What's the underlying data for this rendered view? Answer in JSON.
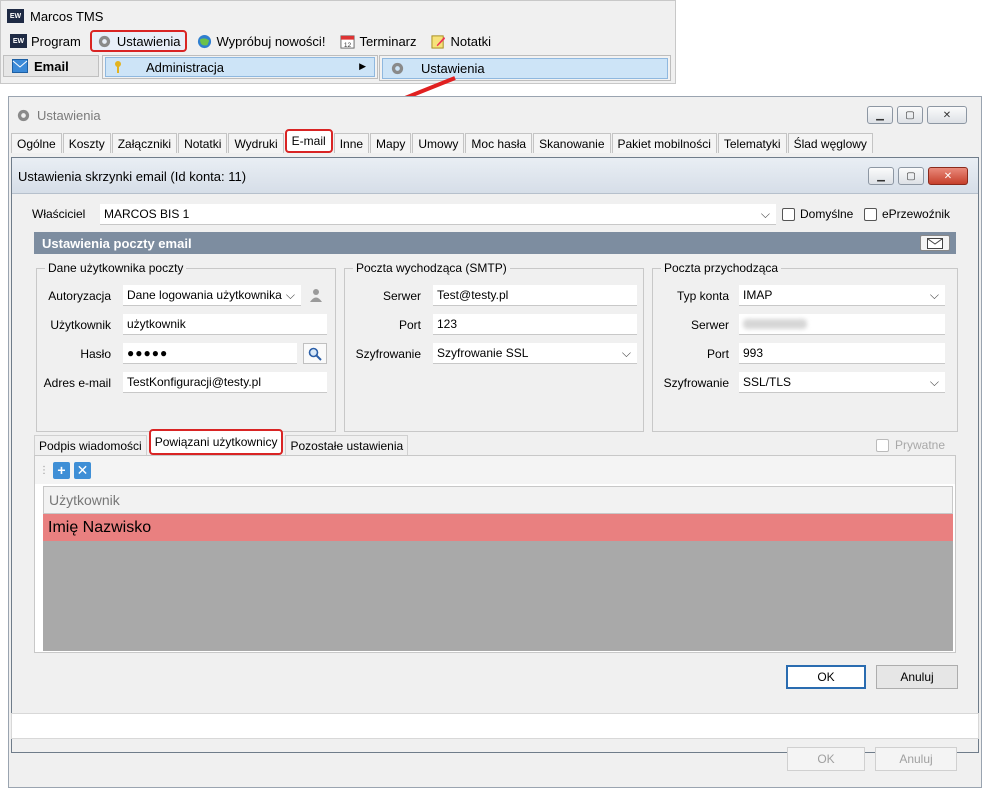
{
  "app": {
    "logo_text": "EW",
    "title": "Marcos TMS",
    "menu": [
      "Program",
      "Ustawienia",
      "Wypróbuj nowości!",
      "Terminarz",
      "Notatki"
    ],
    "email_item": "Email",
    "submenu_item": "Administracja",
    "submenu2_item": "Ustawienia"
  },
  "window": {
    "title": "Ustawienia",
    "tabs": [
      "Ogólne",
      "Koszty",
      "Załączniki",
      "Notatki",
      "Wydruki",
      "E-mail",
      "Inne",
      "Mapy",
      "Umowy",
      "Moc hasła",
      "Skanowanie",
      "Pakiet mobilności",
      "Telematyki",
      "Ślad węglowy"
    ],
    "active_tab": "E-mail",
    "ok_label": "OK",
    "cancel_label": "Anuluj"
  },
  "dialog": {
    "title": "Ustawienia skrzynki email (Id konta: 11)",
    "owner_label": "Właściciel",
    "owner_value": "MARCOS BIS 1",
    "default_label": "Domyślne",
    "carrier_label": "ePrzewoźnik",
    "section_title": "Ustawienia poczty email",
    "user_group": {
      "title": "Dane użytkownika poczty",
      "auth_label": "Autoryzacja",
      "auth_value": "Dane logowania użytkownika",
      "user_label": "Użytkownik",
      "user_value": "użytkownik",
      "password_label": "Hasło",
      "password_value": "●●●●●",
      "email_label": "Adres e-mail",
      "email_value": "TestKonfiguracji@testy.pl"
    },
    "smtp_group": {
      "title": "Poczta wychodząca (SMTP)",
      "server_label": "Serwer",
      "server_value": "Test@testy.pl",
      "port_label": "Port",
      "port_value": "123",
      "enc_label": "Szyfrowanie",
      "enc_value": "Szyfrowanie SSL"
    },
    "incoming_group": {
      "title": "Poczta przychodząca",
      "type_label": "Typ konta",
      "type_value": "IMAP",
      "server_label": "Serwer",
      "port_label": "Port",
      "port_value": "993",
      "enc_label": "Szyfrowanie",
      "enc_value": "SSL/TLS"
    },
    "subtabs": [
      "Podpis wiadomości",
      "Powiązani użytkownicy",
      "Pozostałe ustawienia"
    ],
    "active_subtab": "Powiązani użytkownicy",
    "private_label": "Prywatne",
    "grid": {
      "column": "Użytkownik",
      "rows": [
        "Imię Nazwisko"
      ]
    },
    "ok_label": "OK",
    "cancel_label": "Anuluj"
  },
  "colors": {
    "highlight": "#d92424",
    "selected_row": "#e98080",
    "section_header": "#7d8da0"
  }
}
